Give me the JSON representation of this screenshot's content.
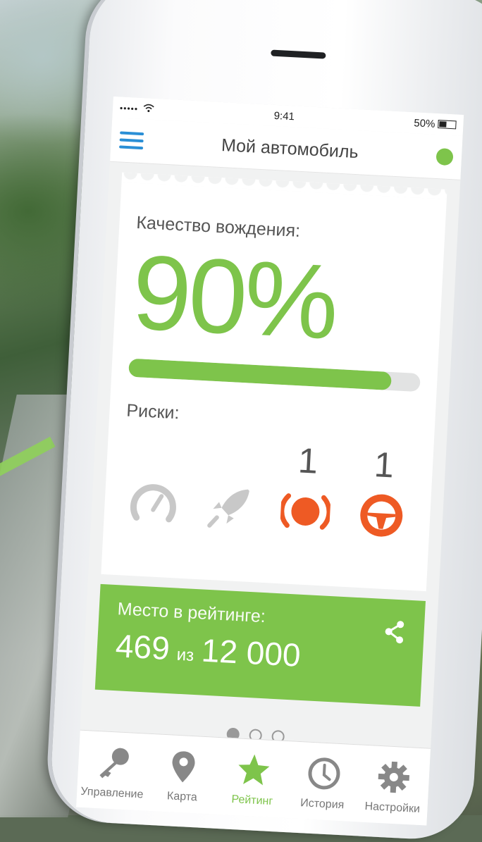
{
  "status_bar": {
    "signal": "•••••",
    "time": "9:41",
    "battery": "50%"
  },
  "navbar": {
    "title": "Мой автомобиль"
  },
  "quality": {
    "label": "Качество вождения:",
    "value": "90%",
    "progress_fraction": 0.9
  },
  "risks": {
    "label": "Риски:",
    "items": [
      {
        "icon": "speedometer-icon",
        "count": "",
        "color": "#c8c8c8"
      },
      {
        "icon": "rocket-icon",
        "count": "",
        "color": "#c8c8c8"
      },
      {
        "icon": "brake-icon",
        "count": "1",
        "color": "#ee5a24"
      },
      {
        "icon": "steering-wheel-icon",
        "count": "1",
        "color": "#ee5a24"
      }
    ]
  },
  "rating": {
    "label": "Место в рейтинге:",
    "place": "469",
    "of": "из",
    "total": "12 000"
  },
  "pager": {
    "pages": 3,
    "active": 0
  },
  "tabs": [
    {
      "label": "Управление",
      "icon": "key-icon",
      "active": false
    },
    {
      "label": "Карта",
      "icon": "map-pin-icon",
      "active": false
    },
    {
      "label": "Рейтинг",
      "icon": "star-icon",
      "active": true
    },
    {
      "label": "История",
      "icon": "clock-icon",
      "active": false
    },
    {
      "label": "Настройки",
      "icon": "gear-icon",
      "active": false
    }
  ],
  "colors": {
    "accent": "#7ec44b",
    "risk": "#ee5a24",
    "menu": "#2a8fd6"
  }
}
